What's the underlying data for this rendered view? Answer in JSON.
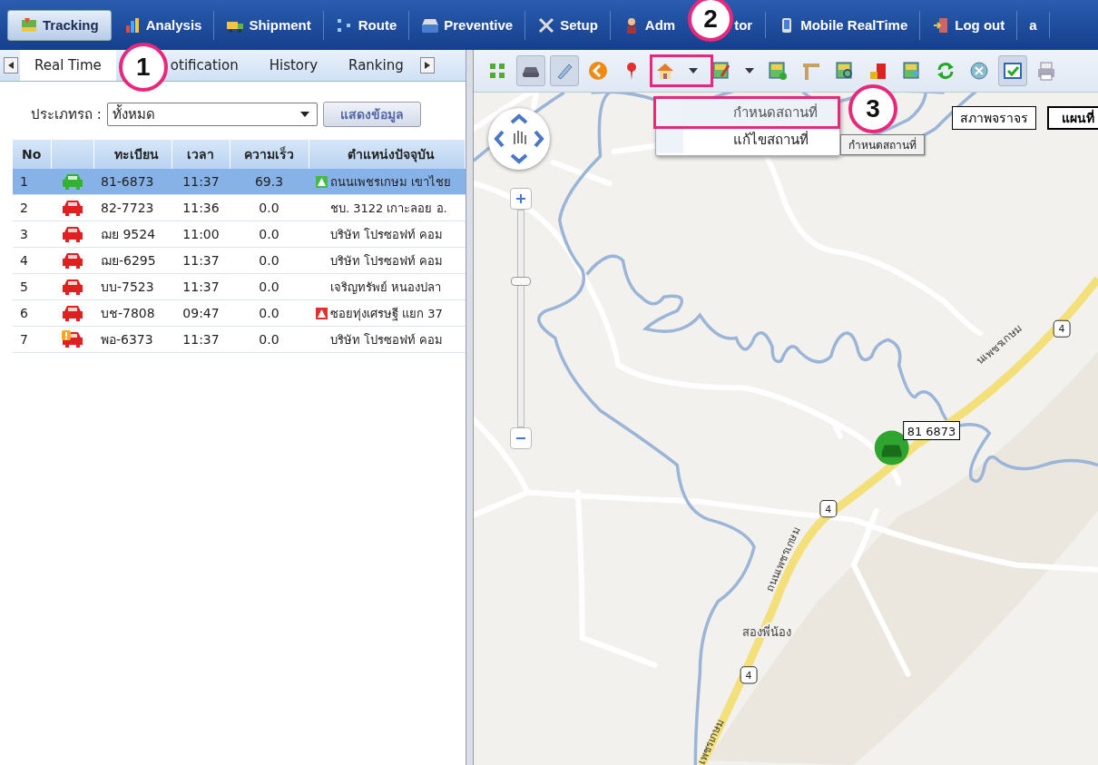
{
  "nav": [
    {
      "kind": "map",
      "label": "Tracking",
      "selected": true
    },
    {
      "kind": "chart",
      "label": "Analysis",
      "selected": false
    },
    {
      "kind": "truck",
      "label": "Shipment",
      "selected": false
    },
    {
      "kind": "route",
      "label": "Route",
      "selected": false
    },
    {
      "kind": "car",
      "label": "Preventive",
      "selected": false
    },
    {
      "kind": "tools",
      "label": "Setup",
      "selected": false
    },
    {
      "kind": "person",
      "label": "Adm",
      "label_tail": "tor",
      "selected": false
    },
    {
      "kind": "phone",
      "label": "Mobile RealTime",
      "selected": false
    },
    {
      "kind": "door",
      "label": "Log out",
      "selected": false
    },
    {
      "kind": "none",
      "label": "a",
      "selected": false
    }
  ],
  "tabs": [
    {
      "label": "Real Time",
      "selected": true
    },
    {
      "label": "otification",
      "selected": false
    },
    {
      "label": "History",
      "selected": false
    },
    {
      "label": "Ranking",
      "selected": false
    }
  ],
  "filter": {
    "label": "ประเภทรถ :",
    "value": "ทั้งหมด",
    "button": "แสดงข้อมูล"
  },
  "table": {
    "columns": [
      "No",
      "",
      "ทะเบียน",
      "เวลา",
      "ความเร็ว",
      "ตำแหน่งปัจจุบัน"
    ],
    "rows": [
      {
        "no": "1",
        "color": "#33b233",
        "warning": false,
        "plate": "81-6873",
        "time": "11:37",
        "speed": "69.3",
        "alert": {
          "color": "#44bb44"
        },
        "location": "ถนนเพชรเกษม เขาไชย",
        "selected": true
      },
      {
        "no": "2",
        "color": "#e02020",
        "warning": false,
        "plate": "82-7723",
        "time": "11:36",
        "speed": "0.0",
        "alert": null,
        "location": "ชบ. 3122 เกาะลอย อ.",
        "selected": false
      },
      {
        "no": "3",
        "color": "#e02020",
        "warning": false,
        "plate": "ฌย 9524",
        "time": "11:00",
        "speed": "0.0",
        "alert": null,
        "location": "บริษัท โปรซอฟท์ คอม",
        "selected": false
      },
      {
        "no": "4",
        "color": "#e02020",
        "warning": false,
        "plate": "ฌย-6295",
        "time": "11:37",
        "speed": "0.0",
        "alert": null,
        "location": "บริษัท โปรซอฟท์ คอม",
        "selected": false
      },
      {
        "no": "5",
        "color": "#e02020",
        "warning": false,
        "plate": "บบ-7523",
        "time": "11:37",
        "speed": "0.0",
        "alert": null,
        "location": "เจริญทรัพย์ หนองปลา",
        "selected": false
      },
      {
        "no": "6",
        "color": "#e02020",
        "warning": false,
        "plate": "บช-7808",
        "time": "09:47",
        "speed": "0.0",
        "alert": {
          "color": "#e03030"
        },
        "location": "ซอยทุ่งเศรษฐี แยก 37",
        "selected": false
      },
      {
        "no": "7",
        "color": "#e02020",
        "warning": true,
        "plate": "พอ-6373",
        "time": "11:37",
        "speed": "0.0",
        "alert": null,
        "location": "บริษัท โปรซอฟท์ คอม",
        "selected": false
      }
    ]
  },
  "toolbar": [
    {
      "kind": "grid",
      "pressed": false
    },
    {
      "kind": "car",
      "pressed": true
    },
    {
      "kind": "tag",
      "pressed": true
    },
    {
      "kind": "back",
      "pressed": false
    },
    {
      "kind": "pin",
      "pressed": false
    },
    {
      "kind": "home",
      "pressed": false
    },
    {
      "kind": "caret",
      "pressed": false
    },
    {
      "kind": "mapedit",
      "pressed": false
    },
    {
      "kind": "caret",
      "pressed": false
    },
    {
      "kind": "mapadd",
      "pressed": false
    },
    {
      "kind": "ruler",
      "pressed": false
    },
    {
      "kind": "mapsearch",
      "pressed": false
    },
    {
      "kind": "fuel",
      "pressed": false
    },
    {
      "kind": "mapperson",
      "pressed": false
    },
    {
      "kind": "refresh",
      "pressed": false
    },
    {
      "kind": "mute",
      "pressed": false
    },
    {
      "kind": "check",
      "pressed": true
    },
    {
      "kind": "print",
      "pressed": false
    }
  ],
  "menu": [
    {
      "label": "กำหนดสถานที่",
      "selected": true
    },
    {
      "label": "แก้ไขสถานที่",
      "selected": false
    }
  ],
  "tooltip": "กำหนดสถานที่",
  "map_buttons": [
    {
      "label": "สภาพจราจร",
      "selected": false
    },
    {
      "label": "แผนที่",
      "selected": true
    }
  ],
  "zoom": {
    "level": 0.68
  },
  "map": {
    "vehicle_label": "81 6873",
    "place": "สองพี่น้อง",
    "shields": [
      "4",
      "4",
      "4"
    ],
    "road_labels": [
      "นเพชรเกษม",
      "ถนนเพชรเกษม",
      "เพชรเกษม"
    ]
  },
  "callouts": [
    "1",
    "2",
    "3"
  ]
}
